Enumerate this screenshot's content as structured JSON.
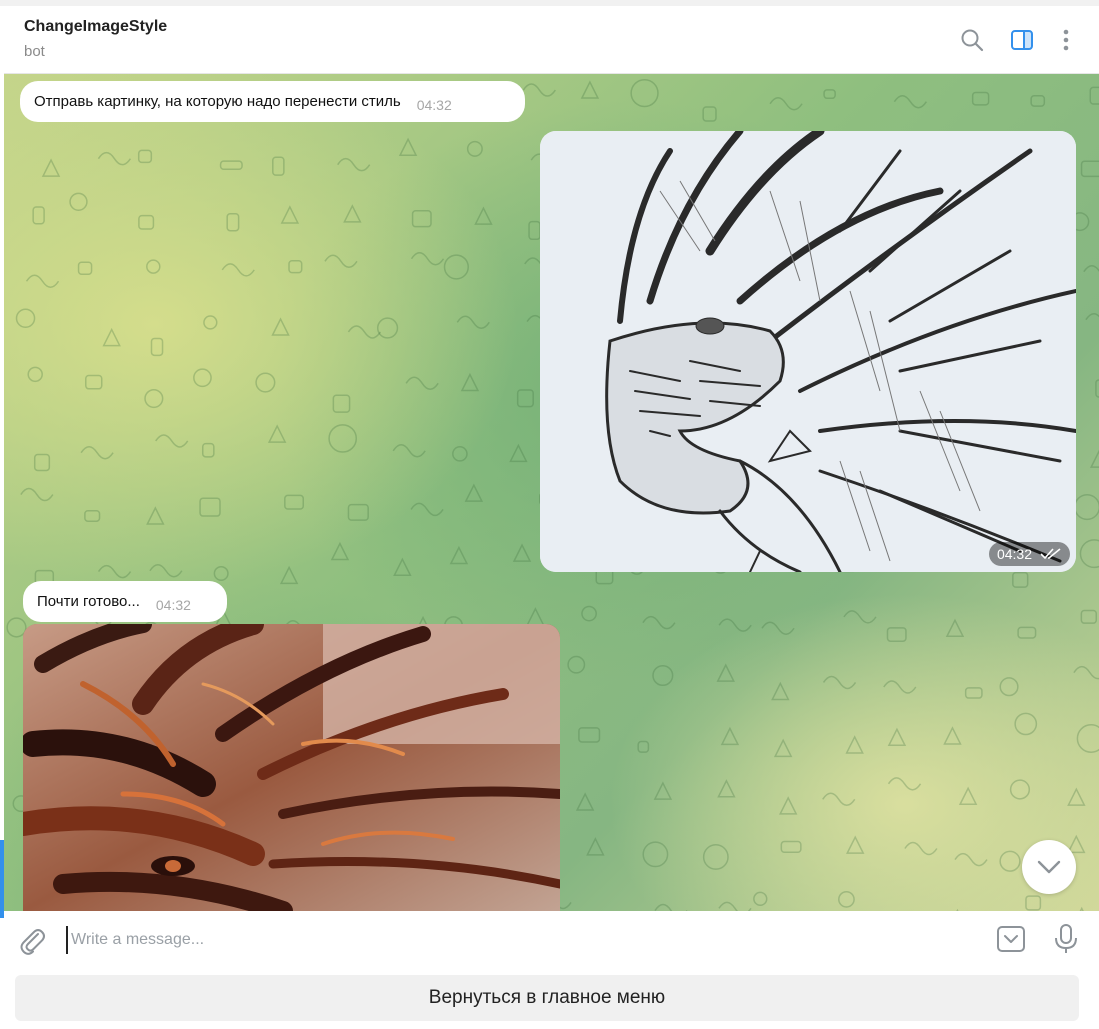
{
  "header": {
    "title": "ChangeImageStyle",
    "subtitle": "bot",
    "icons": [
      "search-icon",
      "sidebar-toggle-icon",
      "more-vertical-icon"
    ]
  },
  "messages": [
    {
      "direction": "incoming",
      "type": "text",
      "text": "Отправь картинку, на которую надо перенести стиль",
      "time": "04:32"
    },
    {
      "direction": "outgoing",
      "type": "photo",
      "description_icon": "dragon-sketch",
      "time": "04:32",
      "status": "read"
    },
    {
      "direction": "incoming",
      "type": "text",
      "text": "Почти готово...",
      "time": "04:32"
    },
    {
      "direction": "incoming",
      "type": "photo",
      "description_icon": "dragon-stylized"
    }
  ],
  "composer": {
    "placeholder": "Write a message...",
    "value": ""
  },
  "keyboard": {
    "button_label": "Вернуться в главное меню"
  },
  "colors": {
    "accent": "#3390ec",
    "bubble": "#ffffff",
    "time": "#a6a6a6",
    "pattern_green": "#8fbf7f",
    "pattern_yellow": "#c5d58a"
  }
}
